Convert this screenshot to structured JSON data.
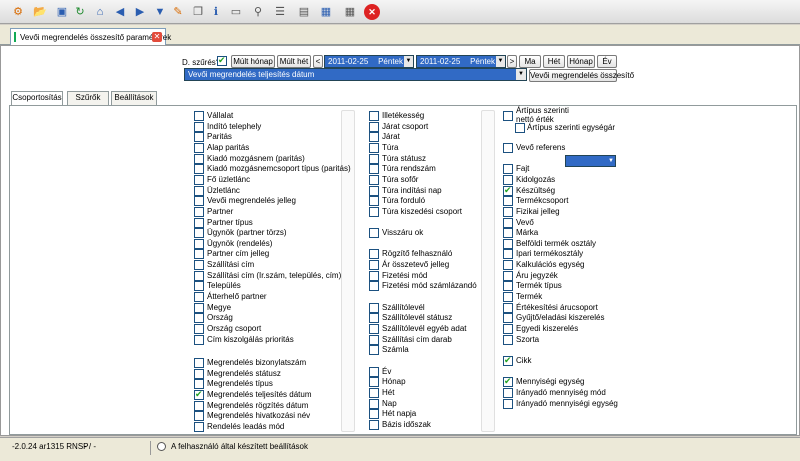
{
  "toolbar": {
    "icons": [
      "tools-icon",
      "open-folder-icon",
      "save-icon",
      "refresh-icon",
      "home-icon",
      "back-icon",
      "forward-icon",
      "down-icon",
      "edit-icon",
      "copy-icon",
      "info-icon",
      "window-icon",
      "search-icon",
      "columns-icon",
      "table-icon",
      "grid-icon",
      "calendar-icon",
      "close-icon"
    ]
  },
  "tab": {
    "title": "Vevői megrendelés összesítő paraméterek"
  },
  "filter": {
    "d_szures_label": "D. szűrés?",
    "d_szures_checked": true,
    "mult_honap": "Múlt hónap",
    "mult_het": "Múlt hét",
    "prev": "<",
    "date_from": "2011-02-25",
    "weekday_from": "Péntek",
    "date_to": "2011-02-25",
    "weekday_to": "Péntek",
    "next": ">",
    "ma": "Ma",
    "het": "Hét",
    "honap": "Hónap",
    "ev": "Év",
    "date_type": "Vevői megrendelés teljesítés dátum",
    "summary_button": "Vevői megrendelés összesítő"
  },
  "subtabs": [
    "Csoportosítás",
    "Szűrők",
    "Beállítások"
  ],
  "columns": {
    "col1": [
      {
        "label": "Vállalat",
        "checked": false
      },
      {
        "label": "Indító telephely",
        "checked": false
      },
      {
        "label": "Paritás",
        "checked": false
      },
      {
        "label": "Alap paritás",
        "checked": false
      },
      {
        "label": "Kiadó mozgásnem (paritás)",
        "checked": false
      },
      {
        "label": "Kiadó mozgásnemcsoport típus (paritás)",
        "checked": false
      },
      {
        "label": "Fő üzletlánc",
        "checked": false
      },
      {
        "label": "Üzletlánc",
        "checked": false
      },
      {
        "label": "Vevői megrendelés jelleg",
        "checked": false
      },
      {
        "label": "Partner",
        "checked": false
      },
      {
        "label": "Partner típus",
        "checked": false
      },
      {
        "label": "Ügynök (partner törzs)",
        "checked": false
      },
      {
        "label": "Ügynök (rendelés)",
        "checked": false
      },
      {
        "label": "Partner cím jelleg",
        "checked": false
      },
      {
        "label": "Szállítási cím",
        "checked": false
      },
      {
        "label": "Szállítási cím (Ir.szám, település, cím)",
        "checked": false
      },
      {
        "label": "Település",
        "checked": false
      },
      {
        "label": "Átterhelő partner",
        "checked": false
      },
      {
        "label": "Megye",
        "checked": false
      },
      {
        "label": "Ország",
        "checked": false
      },
      {
        "label": "Ország csoport",
        "checked": false
      },
      {
        "label": "Cím kiszolgálás prioritás",
        "checked": false
      },
      {
        "label": "Megrendelés bizonylatszám",
        "checked": false
      },
      {
        "label": "Megrendelés státusz",
        "checked": false
      },
      {
        "label": "Megrendelés típus",
        "checked": false
      },
      {
        "label": "Megrendelés teljesítés dátum",
        "checked": true
      },
      {
        "label": "Megrendelés rögzítés dátum",
        "checked": false
      },
      {
        "label": "Megrendelés hivatkozási név",
        "checked": false
      },
      {
        "label": "Rendelés leadás mód",
        "checked": false
      }
    ],
    "col2": [
      {
        "label": "Illetékesség",
        "checked": false
      },
      {
        "label": "Járat csoport",
        "checked": false
      },
      {
        "label": "Járat",
        "checked": false
      },
      {
        "label": "Túra",
        "checked": false
      },
      {
        "label": "Túra státusz",
        "checked": false
      },
      {
        "label": "Túra rendszám",
        "checked": false
      },
      {
        "label": "Túra sofőr",
        "checked": false
      },
      {
        "label": "Túra indítási nap",
        "checked": false
      },
      {
        "label": "Túra forduló",
        "checked": false
      },
      {
        "label": "Túra kiszedési csoport",
        "checked": false
      },
      {
        "label": "Visszáru ok",
        "checked": false
      },
      {
        "label": "Rögzítő felhasználó",
        "checked": false
      },
      {
        "label": "Ár összetevő jelleg",
        "checked": false
      },
      {
        "label": "Fizetési mód",
        "checked": false
      },
      {
        "label": "Fizetési mód számlázandó",
        "checked": false
      },
      {
        "label": "Szállítólevél",
        "checked": false
      },
      {
        "label": "Szállítólevél státusz",
        "checked": false
      },
      {
        "label": "Szállítólevél egyéb adat",
        "checked": false
      },
      {
        "label": "Szállítási cím darab",
        "checked": false
      },
      {
        "label": "Számla",
        "checked": false
      },
      {
        "label": "Év",
        "checked": false
      },
      {
        "label": "Hónap",
        "checked": false
      },
      {
        "label": "Hét",
        "checked": false
      },
      {
        "label": "Nap",
        "checked": false
      },
      {
        "label": "Hét napja",
        "checked": false
      },
      {
        "label": "Bázis időszak",
        "checked": false
      }
    ],
    "col3": [
      {
        "label": "Ártípus szerinti nettó érték",
        "checked": false
      },
      {
        "label": "Ártípus szerinti egységár",
        "checked": false
      },
      {
        "label": "Vevő referens",
        "checked": false
      },
      {
        "label": "Fajt",
        "checked": false
      },
      {
        "label": "Kidolgozás",
        "checked": false
      },
      {
        "label": "Készültség",
        "checked": true
      },
      {
        "label": "Termékcsoport",
        "checked": false
      },
      {
        "label": "Fizikai jelleg",
        "checked": false
      },
      {
        "label": "Vevő",
        "checked": false
      },
      {
        "label": "Márka",
        "checked": false
      },
      {
        "label": "Belföldi termék osztály",
        "checked": false
      },
      {
        "label": "Ipari termékosztály",
        "checked": false
      },
      {
        "label": "Kalkulációs egység",
        "checked": false
      },
      {
        "label": "Áru jegyzék",
        "checked": false
      },
      {
        "label": "Termék típus",
        "checked": false
      },
      {
        "label": "Termék",
        "checked": false
      },
      {
        "label": "Értékesítési árucsoport",
        "checked": false
      },
      {
        "label": "Gyűjtő/eladási kiszerelés",
        "checked": false
      },
      {
        "label": "Egyedi kiszerelés",
        "checked": false
      },
      {
        "label": "Szorta",
        "checked": false
      },
      {
        "label": "Cikk",
        "checked": true
      },
      {
        "label": "Mennyiségi egység",
        "checked": true
      },
      {
        "label": "Irányadó mennyiség mód",
        "checked": false
      },
      {
        "label": "Irányadó mennyiségi egység",
        "checked": false
      }
    ]
  },
  "status": {
    "version": "-2.0.24 ar1315 RNSP",
    "extra": "- / -",
    "message": "A felhasználó által készített beállítások"
  }
}
